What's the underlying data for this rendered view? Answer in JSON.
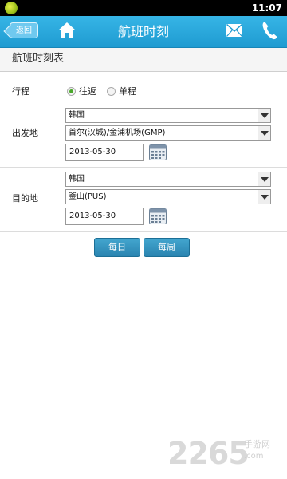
{
  "statusbar": {
    "time": "11:07"
  },
  "titlebar": {
    "back_label": "返回",
    "title": "航班时刻",
    "icons": [
      "home-icon",
      "mail-icon",
      "phone-icon"
    ]
  },
  "section": {
    "title": "航班时刻表"
  },
  "form": {
    "trip": {
      "label": "行程",
      "options": [
        {
          "label": "往返",
          "checked": true
        },
        {
          "label": "单程",
          "checked": false
        }
      ]
    },
    "departure": {
      "label": "出发地",
      "country": "韩国",
      "airport": "首尔(汉城)/金浦机场(GMP)",
      "date": "2013-05-30"
    },
    "destination": {
      "label": "目的地",
      "country": "韩国",
      "airport": "釜山(PUS)",
      "date": "2013-05-30"
    },
    "buttons": {
      "daily": "每日",
      "weekly": "每周"
    }
  },
  "watermark": {
    "digits": "2265",
    "label": "手游网",
    "site": ".com"
  },
  "colors": {
    "titlebar": "#1f9bd1",
    "button": "#2a84b0",
    "radio_checked": "#4aa82c"
  }
}
